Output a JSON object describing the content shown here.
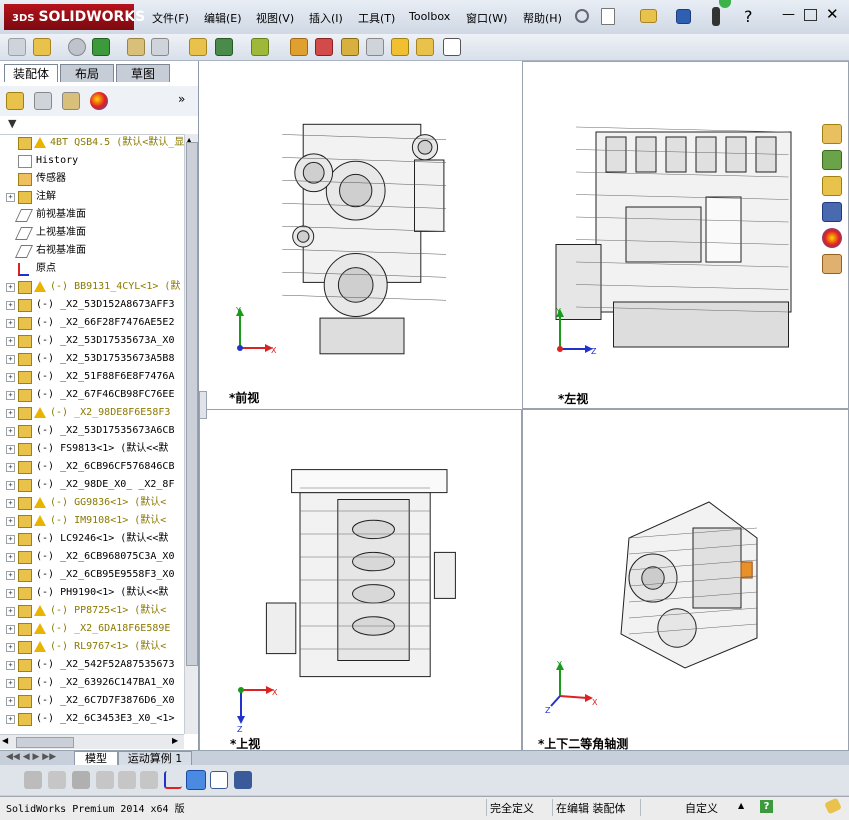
{
  "app": {
    "logo_text": "SOLIDWORKS",
    "logo_prefix": "3DS"
  },
  "menu": [
    "文件(F)",
    "编辑(E)",
    "视图(V)",
    "插入(I)",
    "工具(T)",
    "Toolbox",
    "窗口(W)",
    "帮助(H)"
  ],
  "left_panel": {
    "tabs": [
      "装配体",
      "布局",
      "草图"
    ],
    "tree": [
      {
        "icon": "assembly",
        "warn": true,
        "exp": "",
        "text": "4BT QSB4.5  (默认<默认_显",
        "color": "#8a7a00"
      },
      {
        "icon": "history",
        "warn": false,
        "exp": "",
        "text": "History",
        "color": "#000"
      },
      {
        "icon": "sensor",
        "warn": false,
        "exp": "",
        "text": "传感器",
        "color": "#000"
      },
      {
        "icon": "annotation",
        "warn": false,
        "exp": "+",
        "text": "注解",
        "color": "#000"
      },
      {
        "icon": "plane",
        "warn": false,
        "exp": "",
        "text": "前视基准面",
        "color": "#000"
      },
      {
        "icon": "plane",
        "warn": false,
        "exp": "",
        "text": "上视基准面",
        "color": "#000"
      },
      {
        "icon": "plane",
        "warn": false,
        "exp": "",
        "text": "右视基准面",
        "color": "#000"
      },
      {
        "icon": "origin",
        "warn": false,
        "exp": "",
        "text": "原点",
        "color": "#000"
      },
      {
        "icon": "part",
        "warn": true,
        "exp": "+",
        "text": "(-) BB9131_4CYL<1> (默",
        "color": "#8a7a00"
      },
      {
        "icon": "part",
        "warn": false,
        "exp": "+",
        "text": "(-) _X2_53D152A8673AFF3",
        "color": "#000"
      },
      {
        "icon": "part",
        "warn": false,
        "exp": "+",
        "text": "(-) _X2_66F28F7476AE5E2",
        "color": "#000"
      },
      {
        "icon": "part",
        "warn": false,
        "exp": "+",
        "text": "(-) _X2_53D17535673A_X0",
        "color": "#000"
      },
      {
        "icon": "part",
        "warn": false,
        "exp": "+",
        "text": "(-) _X2_53D17535673A5B8",
        "color": "#000"
      },
      {
        "icon": "part",
        "warn": false,
        "exp": "+",
        "text": "(-) _X2_51F88F6E8F7476A",
        "color": "#000"
      },
      {
        "icon": "part",
        "warn": false,
        "exp": "+",
        "text": "(-) _X2_67F46CB98FC76EE",
        "color": "#000"
      },
      {
        "icon": "part",
        "warn": true,
        "exp": "+",
        "text": "(-) _X2_98DE8F6E58F3",
        "color": "#8a7a00"
      },
      {
        "icon": "part",
        "warn": false,
        "exp": "+",
        "text": "(-) _X2_53D17535673A6CB",
        "color": "#000"
      },
      {
        "icon": "part",
        "warn": false,
        "exp": "+",
        "text": "(-) FS9813<1> (默认<<默",
        "color": "#000"
      },
      {
        "icon": "part",
        "warn": false,
        "exp": "+",
        "text": "(-) _X2_6CB96CF576846CB",
        "color": "#000"
      },
      {
        "icon": "part",
        "warn": false,
        "exp": "+",
        "text": "(-) _X2_98DE_X0_ _X2_8F",
        "color": "#000"
      },
      {
        "icon": "part",
        "warn": true,
        "exp": "+",
        "text": "(-) GG9836<1> (默认<",
        "color": "#8a7a00"
      },
      {
        "icon": "part",
        "warn": true,
        "exp": "+",
        "text": "(-) IM9108<1> (默认<",
        "color": "#8a7a00"
      },
      {
        "icon": "part",
        "warn": false,
        "exp": "+",
        "text": "(-) LC9246<1> (默认<<默",
        "color": "#000"
      },
      {
        "icon": "part",
        "warn": false,
        "exp": "+",
        "text": "(-) _X2_6CB968075C3A_X0",
        "color": "#000"
      },
      {
        "icon": "part",
        "warn": false,
        "exp": "+",
        "text": "(-) _X2_6CB95E9558F3_X0",
        "color": "#000"
      },
      {
        "icon": "part",
        "warn": false,
        "exp": "+",
        "text": "(-) PH9190<1> (默认<<默",
        "color": "#000"
      },
      {
        "icon": "part",
        "warn": true,
        "exp": "+",
        "text": "(-) PP8725<1> (默认<",
        "color": "#8a7a00"
      },
      {
        "icon": "part",
        "warn": true,
        "exp": "+",
        "text": "(-) _X2_6DA18F6E589E",
        "color": "#8a7a00"
      },
      {
        "icon": "part",
        "warn": true,
        "exp": "+",
        "text": "(-) RL9767<1> (默认<",
        "color": "#8a7a00"
      },
      {
        "icon": "part",
        "warn": false,
        "exp": "+",
        "text": "(-) _X2_542F52A87535673",
        "color": "#000"
      },
      {
        "icon": "part",
        "warn": false,
        "exp": "+",
        "text": "(-) _X2_63926C147BA1_X0",
        "color": "#000"
      },
      {
        "icon": "part",
        "warn": false,
        "exp": "+",
        "text": "(-) _X2_6C7D7F3876D6_X0",
        "color": "#000"
      },
      {
        "icon": "part",
        "warn": false,
        "exp": "+",
        "text": "(-) _X2_6C3453E3_X0_<1>",
        "color": "#000"
      }
    ]
  },
  "viewports": {
    "front": {
      "label": "*前视"
    },
    "left": {
      "label": "*左视"
    },
    "top": {
      "label": "*上视"
    },
    "iso": {
      "label": "*上下二等角轴测"
    }
  },
  "bottom_tabs": [
    "模型",
    "运动算例 1"
  ],
  "status": {
    "product": "SolidWorks Premium 2014 x64 版",
    "constraint": "完全定义",
    "editing": "在编辑 装配体",
    "custom": "自定义"
  },
  "colors": {
    "accent": "#b5121b",
    "warn": "#e8b400",
    "axis_x": "#d22",
    "axis_y": "#1a9a1a",
    "axis_z": "#2233cc"
  }
}
